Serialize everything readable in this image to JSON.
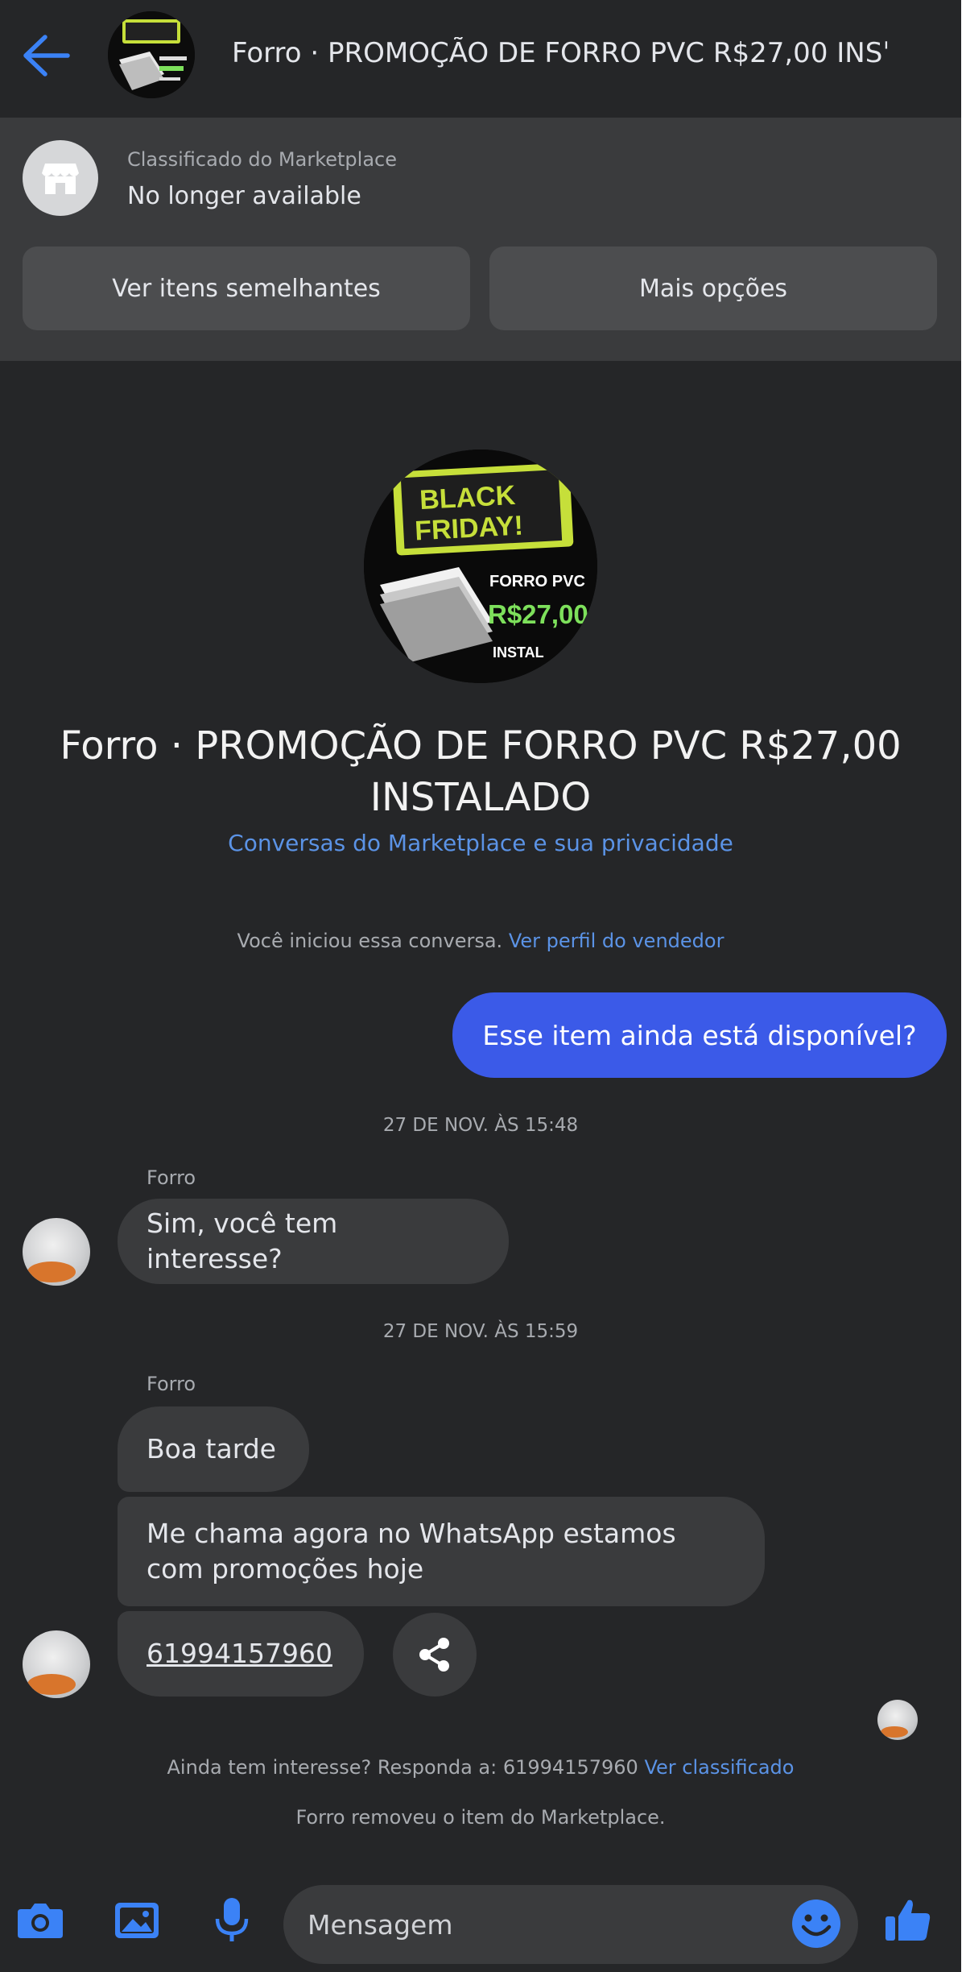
{
  "topbar": {
    "back_icon": "arrow-left-icon",
    "title": "Forro · PROMOÇÃO DE FORRO PVC R$27,00 INSˈ"
  },
  "banner": {
    "icon": "storefront-icon",
    "label": "Classificado do Marketplace",
    "status": "No longer available",
    "similar_button": "Ver itens semelhantes",
    "more_button": "Mais opções"
  },
  "listing_image": {
    "line1": "BLACK",
    "line2": "FRIDAY!",
    "product": "FORRO PVC",
    "price": "R$27,00",
    "footer": "INSTAL"
  },
  "listing": {
    "title": "Forro · PROMOÇÃO DE FORRO PVC R$27,00 INSTALADO",
    "privacy_link": "Conversas do Marketplace e sua privacidade",
    "started_text": "Você iniciou essa conversa.",
    "seller_link": "Ver perfil do vendedor"
  },
  "messages": {
    "sent_1": "Esse item ainda está disponível?",
    "timestamp_1": "27 DE NOV. ÀS 15:48",
    "sender_1": "Forro",
    "received_1": "Sim, você tem interesse?",
    "timestamp_2": "27 DE NOV. ÀS 15:59",
    "sender_2": "Forro",
    "received_2": "Boa tarde",
    "received_3": "Me chama agora no WhatsApp estamos com promoções hoje",
    "received_4": "61994157960"
  },
  "footer_notes": {
    "still_interested": "Ainda tem interesse? Responda a: 61994157960",
    "listing_link": "Ver classificado",
    "removed": "Forro removeu o item do Marketplace."
  },
  "composer": {
    "placeholder": "Mensagem",
    "icons": [
      "camera-icon",
      "gallery-icon",
      "mic-icon",
      "emoji-icon",
      "thumbs-up-icon"
    ]
  },
  "colors": {
    "accent": "#3b5ae8",
    "link": "#5b93e6",
    "background": "#252628",
    "bubble": "#3a3b3d"
  }
}
